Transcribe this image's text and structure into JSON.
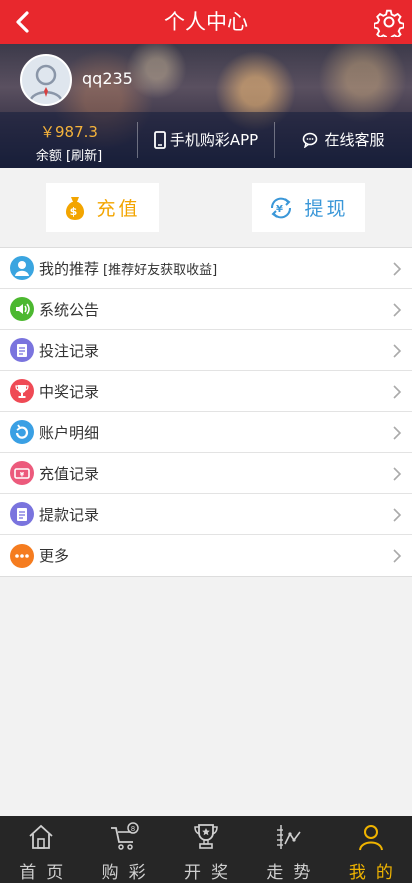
{
  "header": {
    "title": "个人中心",
    "back_icon": "chevron-left-icon",
    "settings_icon": "gear-icon"
  },
  "profile": {
    "username": "qq235",
    "balance": "￥987.3",
    "balance_label": "余额 [刷新]",
    "app_link": "手机购彩APP",
    "service_link": "在线客服"
  },
  "actions": {
    "charge": "充值",
    "withdraw": "提现"
  },
  "menu": {
    "items": [
      {
        "label": "我的推荐",
        "sub": "[推荐好友获取收益]",
        "icon": "user-icon",
        "color": "#3aa5e0"
      },
      {
        "label": "系统公告",
        "sub": "",
        "icon": "speaker-icon",
        "color": "#4cb830"
      },
      {
        "label": "投注记录",
        "sub": "",
        "icon": "notepad-icon",
        "color": "#7a74de"
      },
      {
        "label": "中奖记录",
        "sub": "",
        "icon": "trophy-icon",
        "color": "#ef4a55"
      },
      {
        "label": "账户明细",
        "sub": "",
        "icon": "refresh-icon",
        "color": "#3aa0e4"
      },
      {
        "label": "充值记录",
        "sub": "",
        "icon": "card-icon",
        "color": "#ec5a7c"
      },
      {
        "label": "提款记录",
        "sub": "",
        "icon": "notepad-icon",
        "color": "#7a74de"
      },
      {
        "label": "更多",
        "sub": "",
        "icon": "more-icon",
        "color": "#f57c1f"
      }
    ]
  },
  "tabbar": {
    "tabs": [
      {
        "label": "首页",
        "icon": "home-icon"
      },
      {
        "label": "购彩",
        "icon": "cart-icon"
      },
      {
        "label": "开奖",
        "icon": "trophy-icon"
      },
      {
        "label": "走势",
        "icon": "trend-icon"
      },
      {
        "label": "我的",
        "icon": "person-icon"
      }
    ],
    "active_color": "#f0b400"
  }
}
